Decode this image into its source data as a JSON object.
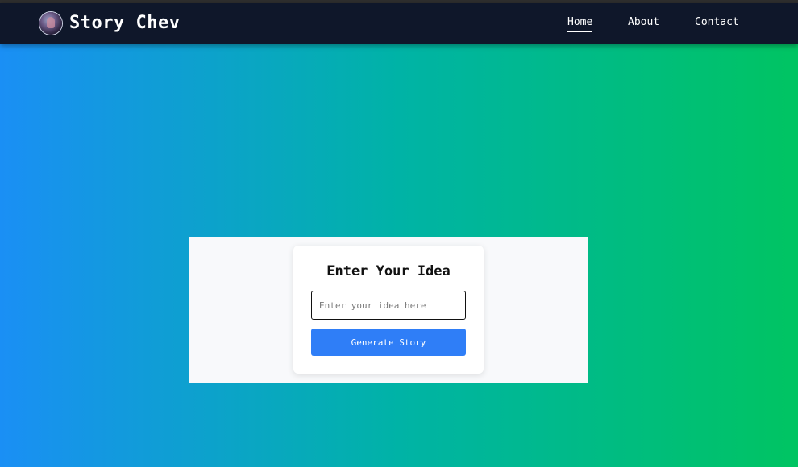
{
  "nav": {
    "brand": "Story Chev",
    "logo_icon": "avatar-logo-icon",
    "links": [
      {
        "label": "Home",
        "active": true
      },
      {
        "label": "About",
        "active": false
      },
      {
        "label": "Contact",
        "active": false
      }
    ]
  },
  "form": {
    "title": "Enter Your Idea",
    "input_value": "",
    "input_placeholder": "Enter your idea here",
    "button_label": "Generate Story"
  },
  "colors": {
    "navbar_bg": "#0f172a",
    "gradient_start": "#1a8ff5",
    "gradient_end": "#00c462",
    "button_bg": "#2f7ef7",
    "panel_bg": "#f8f9fb",
    "card_bg": "#ffffff"
  }
}
